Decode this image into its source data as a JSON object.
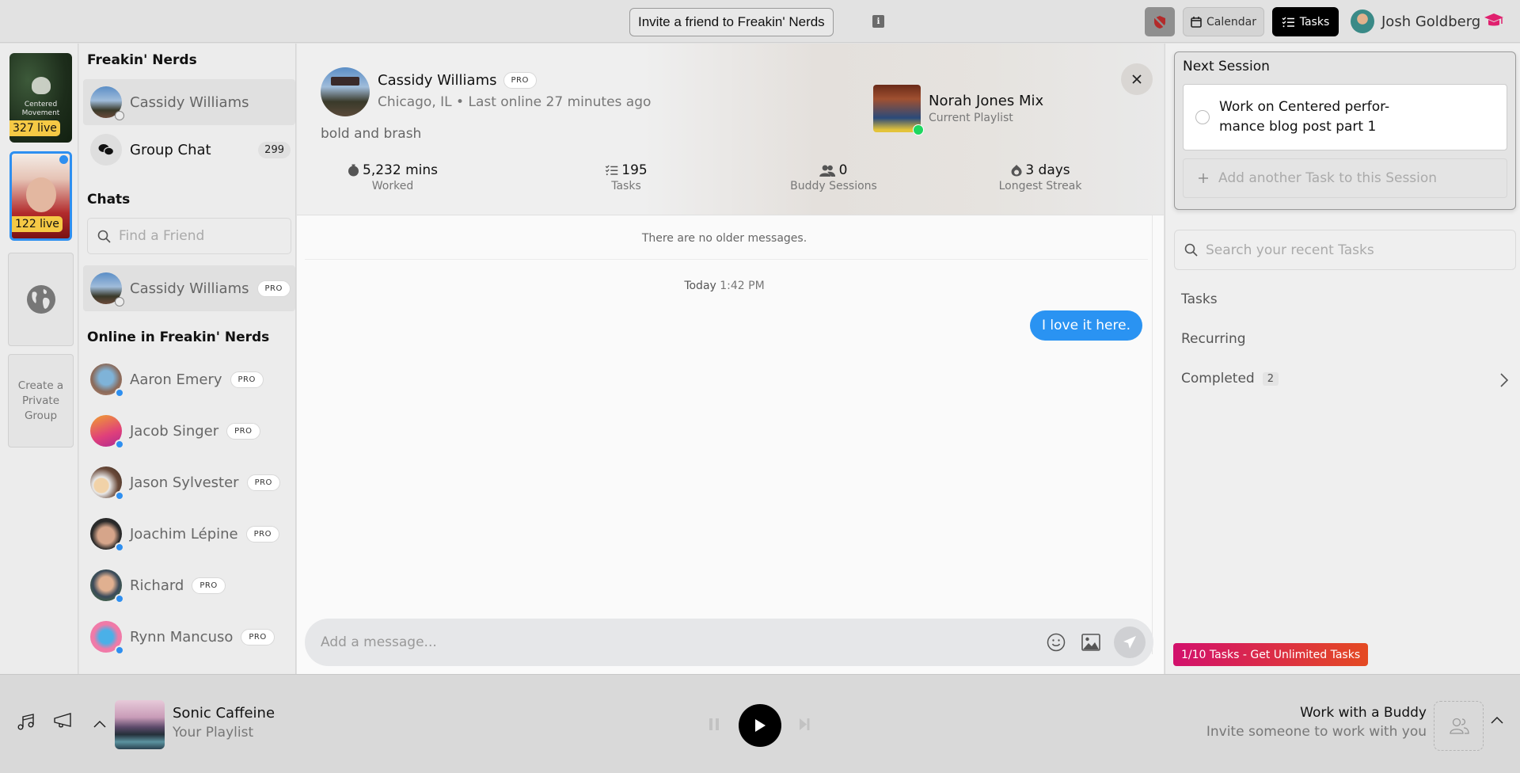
{
  "topbar": {
    "invite_label": "Invite a friend to Freakin' Nerds",
    "info_label": "i",
    "calendar_label": "Calendar",
    "tasks_label": "Tasks",
    "user_name": "Josh Goldberg"
  },
  "rail": {
    "groups": [
      {
        "name": "Centered Movement",
        "live": "327 live"
      },
      {
        "name": "Freakin' Nerds",
        "live": "122 live",
        "selected": true
      }
    ],
    "create_label": "Create a Private Group"
  },
  "sidebar": {
    "group_title": "Freakin' Nerds",
    "pinned_user": "Cassidy Williams",
    "group_chat_label": "Group Chat",
    "group_chat_count": "299",
    "chats_title": "Chats",
    "search_placeholder": "Find a Friend",
    "chats": [
      {
        "name": "Cassidy Williams",
        "badge": "PRO",
        "online": false
      }
    ],
    "online_title": "Online in Freakin' Nerds",
    "online": [
      {
        "name": "Aaron Emery",
        "badge": "PRO"
      },
      {
        "name": "Jacob Singer",
        "badge": "PRO"
      },
      {
        "name": "Jason Sylvester",
        "badge": "PRO"
      },
      {
        "name": "Joachim Lépine",
        "badge": "PRO"
      },
      {
        "name": "Richard",
        "badge": "PRO"
      },
      {
        "name": "Rynn Mancuso",
        "badge": "PRO"
      }
    ]
  },
  "profile": {
    "name": "Cassidy Williams",
    "badge": "PRO",
    "location": "Chicago, IL",
    "separator": " • ",
    "last_online": "Last online 27 minutes ago",
    "bio": "bold and brash",
    "playlist_title": "Norah Jones Mix",
    "playlist_sub": "Current Playlist",
    "stats": [
      {
        "value": "5,232 mins",
        "label": "Worked",
        "icon": "stopwatch-icon"
      },
      {
        "value": "195",
        "label": "Tasks",
        "icon": "checklist-icon"
      },
      {
        "value": "0",
        "label": "Buddy Sessions",
        "icon": "people-icon"
      },
      {
        "value": "3 days",
        "label": "Longest Streak",
        "icon": "flame-icon"
      }
    ]
  },
  "messages": {
    "no_older": "There are no older messages.",
    "day": "Today",
    "time": "1:42 PM",
    "items": [
      {
        "text": "I love it here.",
        "from_me": true
      }
    ],
    "composer_placeholder": "Add a message..."
  },
  "tasks_panel": {
    "session_title": "Next Session",
    "session_tasks": [
      {
        "text": "Work on Centered perfor-mance blog post part 1",
        "done": false
      }
    ],
    "add_task_label": "Add another Task to this Session",
    "search_placeholder": "Search your recent Tasks",
    "sections": [
      {
        "label": "Tasks"
      },
      {
        "label": "Recurring"
      },
      {
        "label": "Completed",
        "count": "2"
      }
    ],
    "upgrade_label": "1/10 Tasks - Get Unlimited Tasks"
  },
  "player": {
    "title": "Sonic Caffeine",
    "subtitle": "Your Playlist",
    "buddy_title": "Work with a Buddy",
    "buddy_sub": "Invite someone to work with you"
  },
  "colors": {
    "accent_blue": "#2a93f2",
    "live_badge": "#f5c945",
    "upgrade_start": "#d2106c",
    "upgrade_end": "#e44a22",
    "grad_cap": "#e0206e",
    "shield_red": "#b32a2a"
  }
}
